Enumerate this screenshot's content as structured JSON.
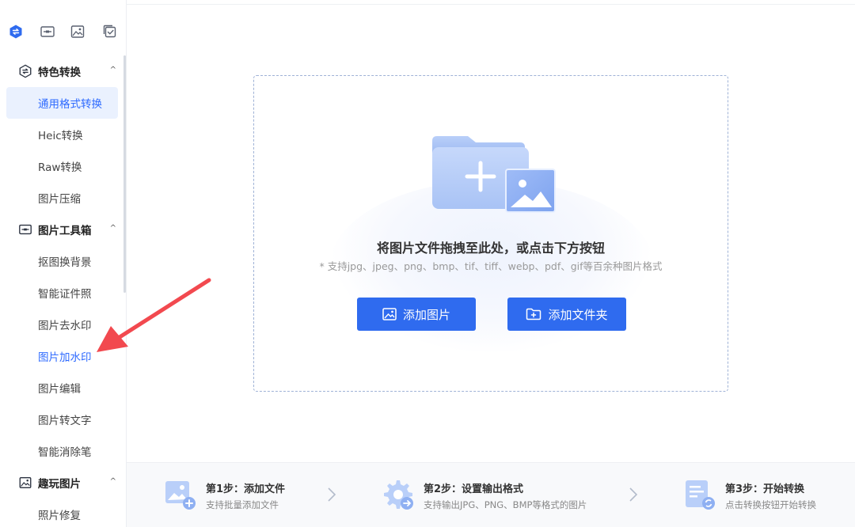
{
  "sidebar": {
    "groups": [
      {
        "label": "特色转换",
        "items": [
          "通用格式转换",
          "Heic转换",
          "Raw转换",
          "图片压缩"
        ]
      },
      {
        "label": "图片工具箱",
        "items": [
          "抠图换背景",
          "智能证件照",
          "图片去水印",
          "图片加水印",
          "图片编辑",
          "图片转文字",
          "智能消除笔"
        ]
      },
      {
        "label": "趣玩图片",
        "items": [
          "照片修复"
        ]
      }
    ],
    "active_item": "通用格式转换",
    "highlighted_item": "图片加水印"
  },
  "dropzone": {
    "title": "将图片文件拖拽至此处，或点击下方按钮",
    "subtitle": "* 支持jpg、jpeg、png、bmp、tif、tiff、webp、pdf、gif等百余种图片格式",
    "add_image_label": "添加图片",
    "add_folder_label": "添加文件夹"
  },
  "steps": [
    {
      "title": "第1步：添加文件",
      "desc": "支持批量添加文件"
    },
    {
      "title": "第2步：设置输出格式",
      "desc": "支持输出JPG、PNG、BMP等格式的图片"
    },
    {
      "title": "第3步：开始转换",
      "desc": "点击转换按钮开始转换"
    }
  ],
  "colors": {
    "accent": "#2f6bef",
    "active_bg": "#eaf1fe",
    "annotation_red": "#f2494f"
  },
  "icons": {
    "mode_tabs": [
      "convert-mode-icon",
      "toolbox-mode-icon",
      "image-play-mode-icon",
      "checklist-mode-icon"
    ]
  }
}
